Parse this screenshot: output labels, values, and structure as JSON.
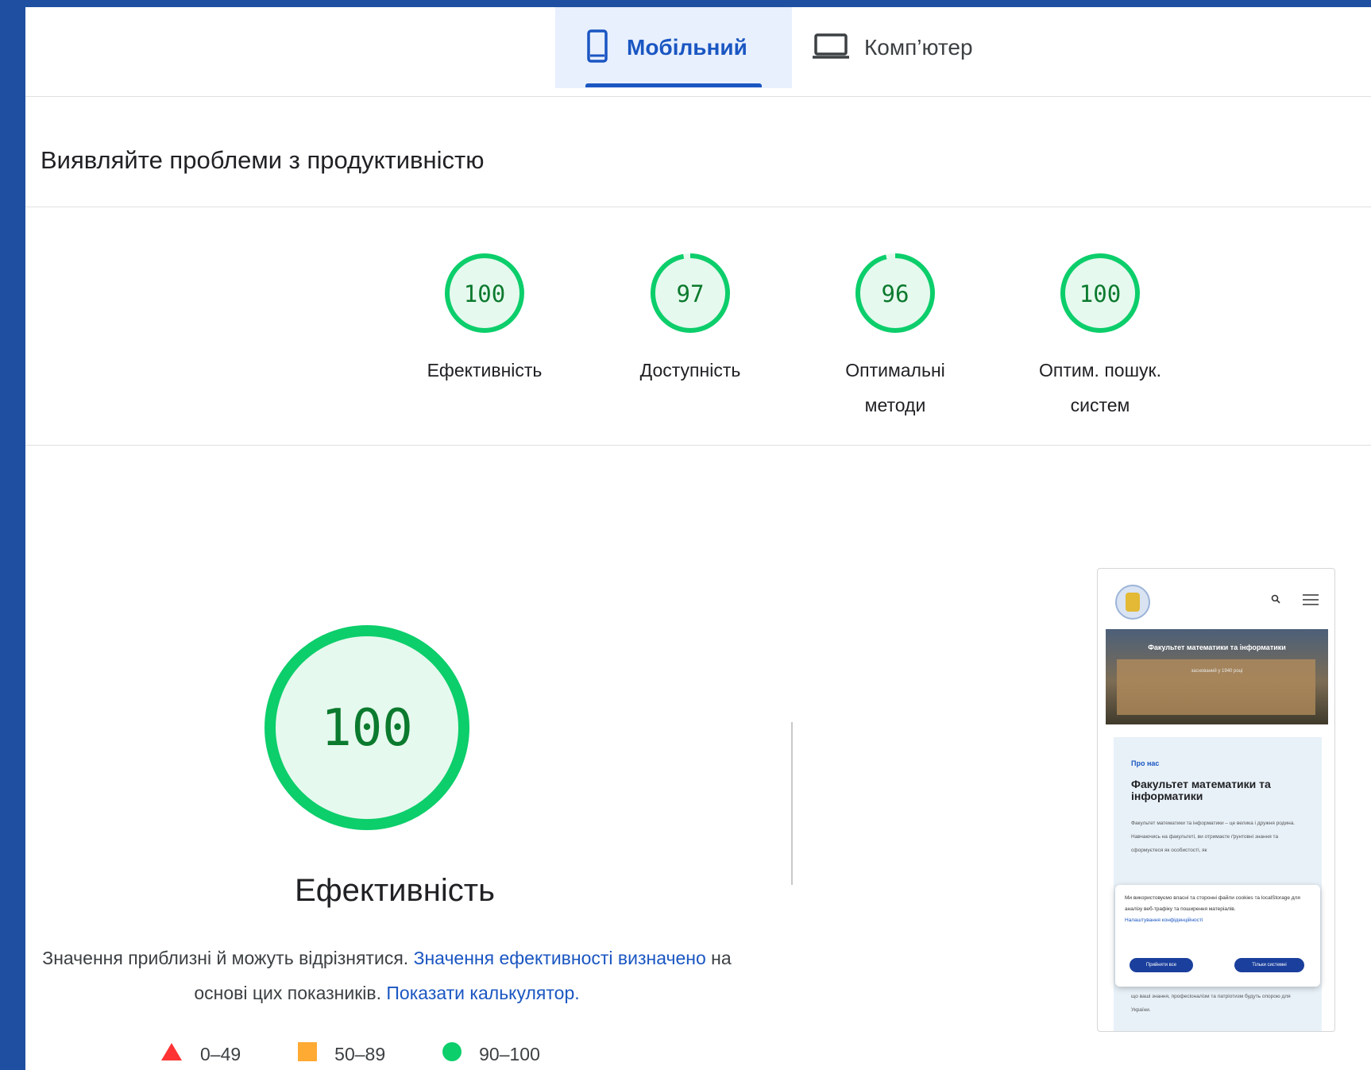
{
  "tabs": {
    "mobile_label": "Мобільний",
    "desktop_label": "Комп’ютер"
  },
  "section_title": "Виявляйте проблеми з продуктивністю",
  "scores": [
    {
      "value": "100",
      "label_line1": "Ефективність",
      "label_line2": ""
    },
    {
      "value": "97",
      "label_line1": "Доступність",
      "label_line2": ""
    },
    {
      "value": "96",
      "label_line1": "Оптимальні",
      "label_line2": "методи"
    },
    {
      "value": "100",
      "label_line1": "Оптим. пошук.",
      "label_line2": "систем"
    }
  ],
  "main": {
    "score": "100",
    "title": "Ефективність",
    "note_prefix": "Значення приблизні й можуть відрізнятися. ",
    "note_link1": "Значення ефективності визначено",
    "note_middle": " на основі цих показників. ",
    "note_link2": "Показати калькулятор."
  },
  "legend": {
    "red": "0–49",
    "orange": "50–89",
    "green": "90–100"
  },
  "colors": {
    "pass_green": "#0cce6b",
    "pass_fill": "#e6f9ee",
    "score_text": "#0b7a2e",
    "fail_red": "#ff3333",
    "average_orange": "#ffaa33",
    "accent_blue": "#1a56c2"
  },
  "thumbnail": {
    "hero_title": "Факультет математики та інформатики",
    "hero_subtitle": "заснований у 1940 році",
    "kicker": "Про нас",
    "heading": "Факультет математики та інформатики",
    "paragraph": "Факультет математики та інформатики – це велика і дружня родина. Навчаючись на факультеті, ви отримаєте ґрунтовні знання та сформуєтеся як особистості, як",
    "paragraph_end": "що ваші знання, професіоналізм та патріотизм будуть опорою для України.",
    "cookie_text": "Ми використовуємо власні та сторонні файли cookies та localStorage для аналізу веб-трафіку та поширення матеріалів.",
    "cookie_link": "Налаштування конфіденційності",
    "accept_all": "Прийняти все",
    "system_only": "Тільки системні"
  }
}
